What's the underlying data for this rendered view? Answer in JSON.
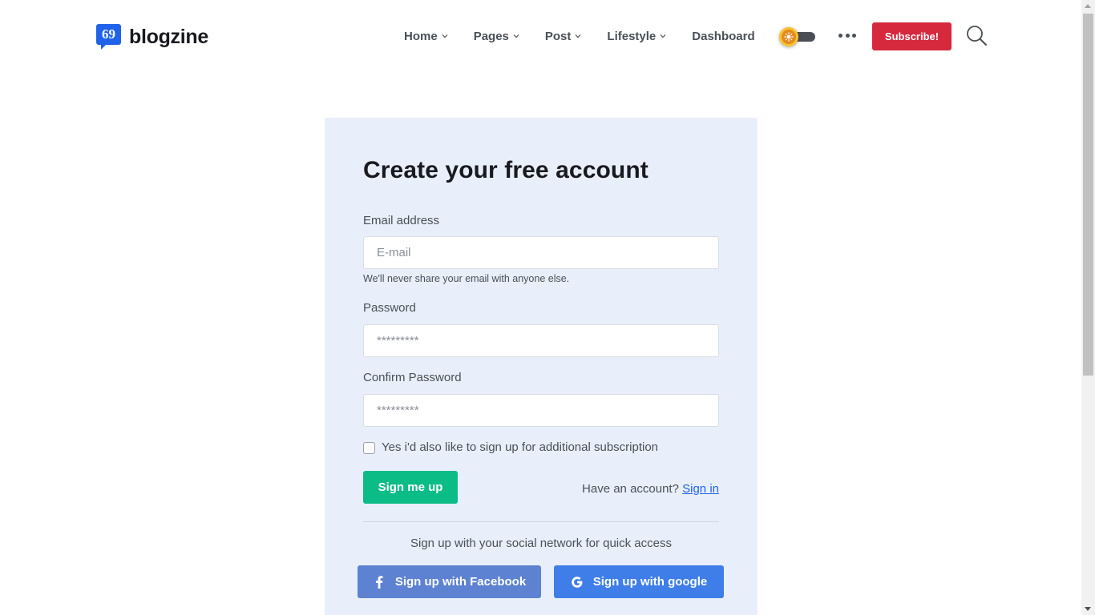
{
  "header": {
    "logo_icon": "speech-bubble-quote-icon",
    "logo_text": "blogzine",
    "nav": [
      {
        "label": "Home",
        "has_dropdown": true
      },
      {
        "label": "Pages",
        "has_dropdown": true
      },
      {
        "label": "Post",
        "has_dropdown": true
      },
      {
        "label": "Lifestyle",
        "has_dropdown": true
      },
      {
        "label": "Dashboard",
        "has_dropdown": false
      }
    ],
    "theme_toggle_icon": "sun-icon",
    "more_icon": "ellipsis-icon",
    "subscribe_label": "Subscribe!",
    "search_icon": "search-icon"
  },
  "form": {
    "title": "Create your free account",
    "email_label": "Email address",
    "email_placeholder": "E-mail",
    "email_help": "We'll never share your email with anyone else.",
    "password_label": "Password",
    "password_placeholder": "*********",
    "confirm_label": "Confirm Password",
    "confirm_placeholder": "*********",
    "checkbox_label": "Yes i'd also like to sign up for additional subscription",
    "checkbox_checked": false,
    "submit_label": "Sign me up",
    "have_account_text": "Have an account?",
    "sign_in_link": "Sign in",
    "social_text": "Sign up with your social network for quick access",
    "facebook_label": "Sign up with Facebook",
    "google_label": "Sign up with google"
  },
  "colors": {
    "brand_blue": "#2163e8",
    "subscribe_red": "#d6293e",
    "success_green": "#0cbc87",
    "facebook_blue": "#5d82d1",
    "google_blue": "#3f7ee8",
    "card_bg": "#e8effa",
    "toggle_sun": "#f7c32e"
  }
}
